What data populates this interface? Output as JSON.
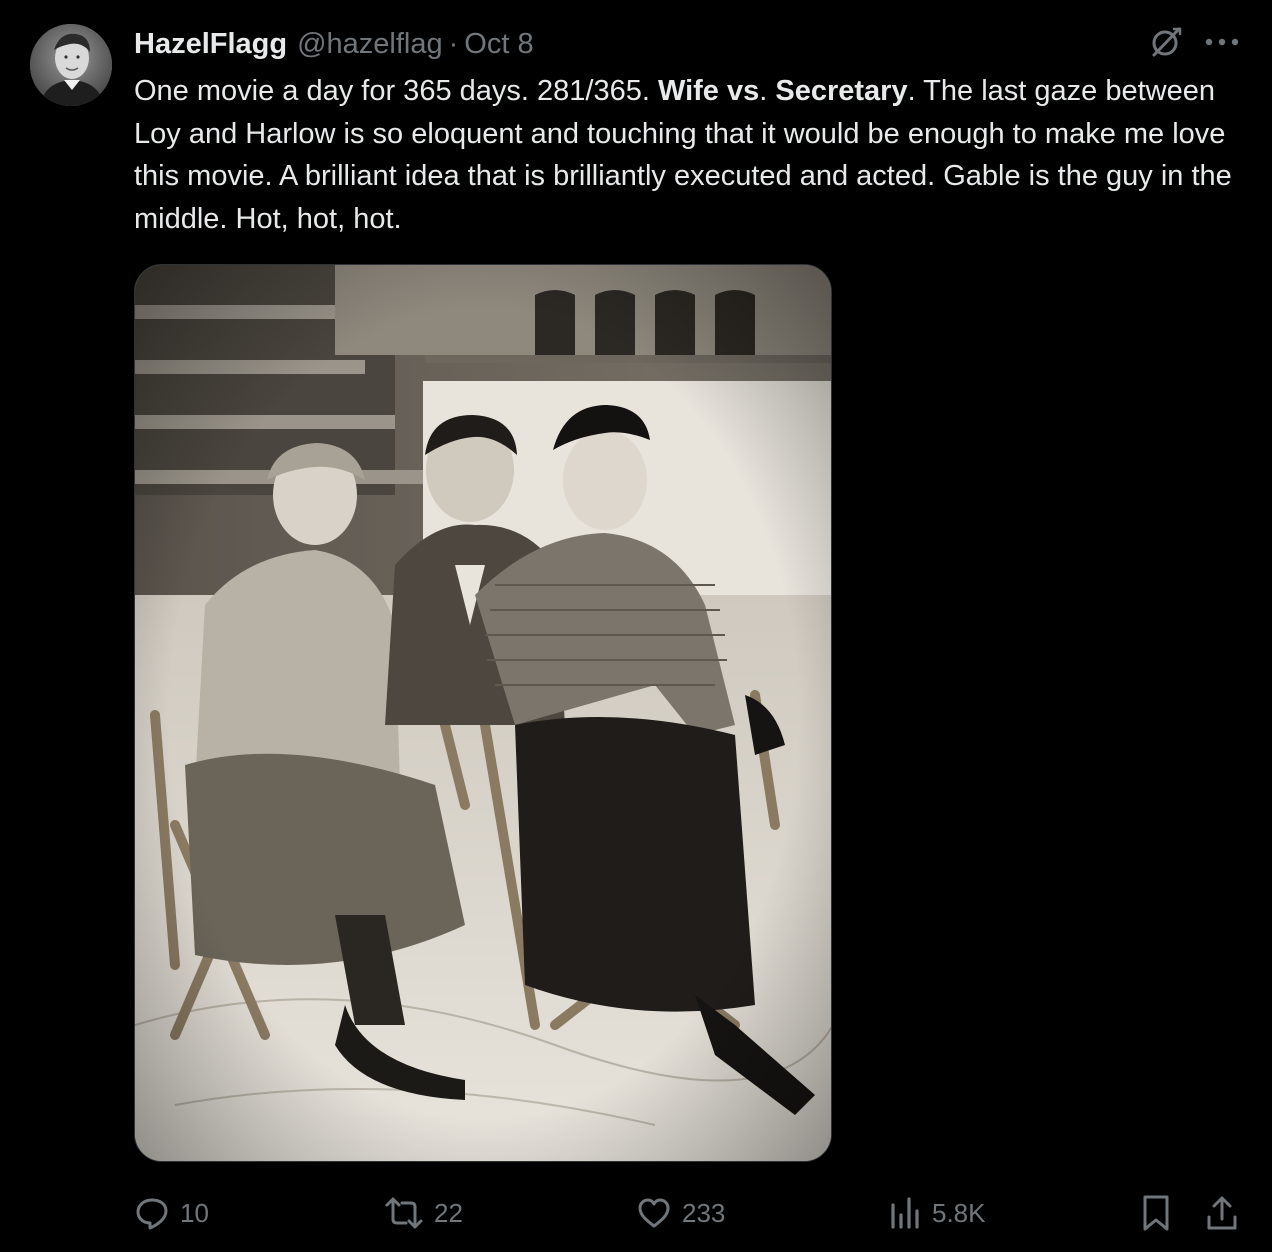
{
  "post": {
    "display_name": "HazelFlagg",
    "handle": "@hazelflag",
    "separator": "·",
    "time": "Oct 8",
    "text_parts": {
      "p1": "One movie a day for 365 days. 281/365. ",
      "b1": "Wife vs",
      "p2": ". ",
      "b2": "Secretary",
      "p3": ". The last gaze between Loy and Harlow is so eloquent and touching that it would be enough to make me love this movie. A brilliant idea that is brilliantly executed and acted. Gable is the guy in the middle. Hot, hot, hot."
    }
  },
  "icons": {
    "avatar": "avatar-photo",
    "grok": "grok-icon",
    "more": "more-icon",
    "reply": "reply-icon",
    "repost": "repost-icon",
    "like": "like-icon",
    "views": "views-icon",
    "bookmark": "bookmark-icon",
    "share": "share-icon"
  },
  "actions": {
    "replies": "10",
    "reposts": "22",
    "likes": "233",
    "views": "5.8K"
  },
  "colors": {
    "background": "#000000",
    "text": "#e7e9ea",
    "secondary": "#71767b",
    "border": "#2f3336"
  }
}
